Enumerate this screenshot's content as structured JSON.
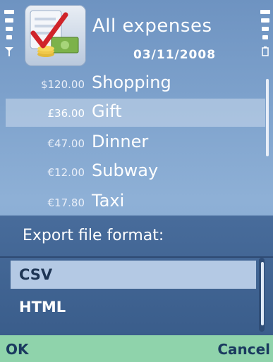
{
  "header": {
    "title": "All expenses",
    "date": "03/11/2008",
    "app_icon": "expense-app-icon",
    "signal_icon": "antenna-icon",
    "battery_icon": "battery-icon"
  },
  "expenses": [
    {
      "amount": "$120.00",
      "name": "Shopping"
    },
    {
      "amount": "£36.00",
      "name": "Gift"
    },
    {
      "amount": "€47.00",
      "name": "Dinner"
    },
    {
      "amount": "€12.00",
      "name": "Subway"
    },
    {
      "amount": "€17.80",
      "name": "Taxi"
    }
  ],
  "selected_expense_index": 1,
  "dialog": {
    "title": "Export file format:",
    "options": [
      "CSV",
      "HTML"
    ],
    "selected_option_index": 0
  },
  "softkeys": {
    "left": "OK",
    "right": "Cancel"
  },
  "colors": {
    "background": "#7fa3cd",
    "dialog": "#3a5d8b",
    "highlight": "#b4c9e4",
    "softkey_bar": "#8fd3ab",
    "softkey_text": "#1a3a5f"
  }
}
